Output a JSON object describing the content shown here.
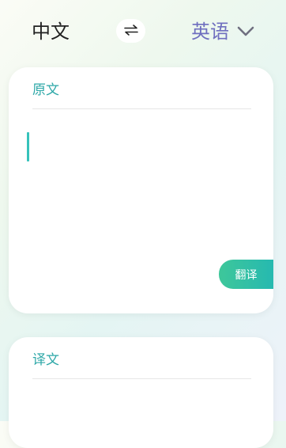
{
  "language_bar": {
    "source_language": "中文",
    "target_language": "英语",
    "swap_icon": "swap-arrows-icon",
    "dropdown_icon": "chevron-down-icon"
  },
  "source_card": {
    "title": "原文",
    "input_value": "",
    "translate_button_label": "翻译"
  },
  "output_card": {
    "title": "译文"
  },
  "colors": {
    "accent_teal": "#2ea8a8",
    "target_language": "#6f6fbf",
    "button_gradient_start": "#3ec79a",
    "button_gradient_end": "#26b9b0"
  }
}
